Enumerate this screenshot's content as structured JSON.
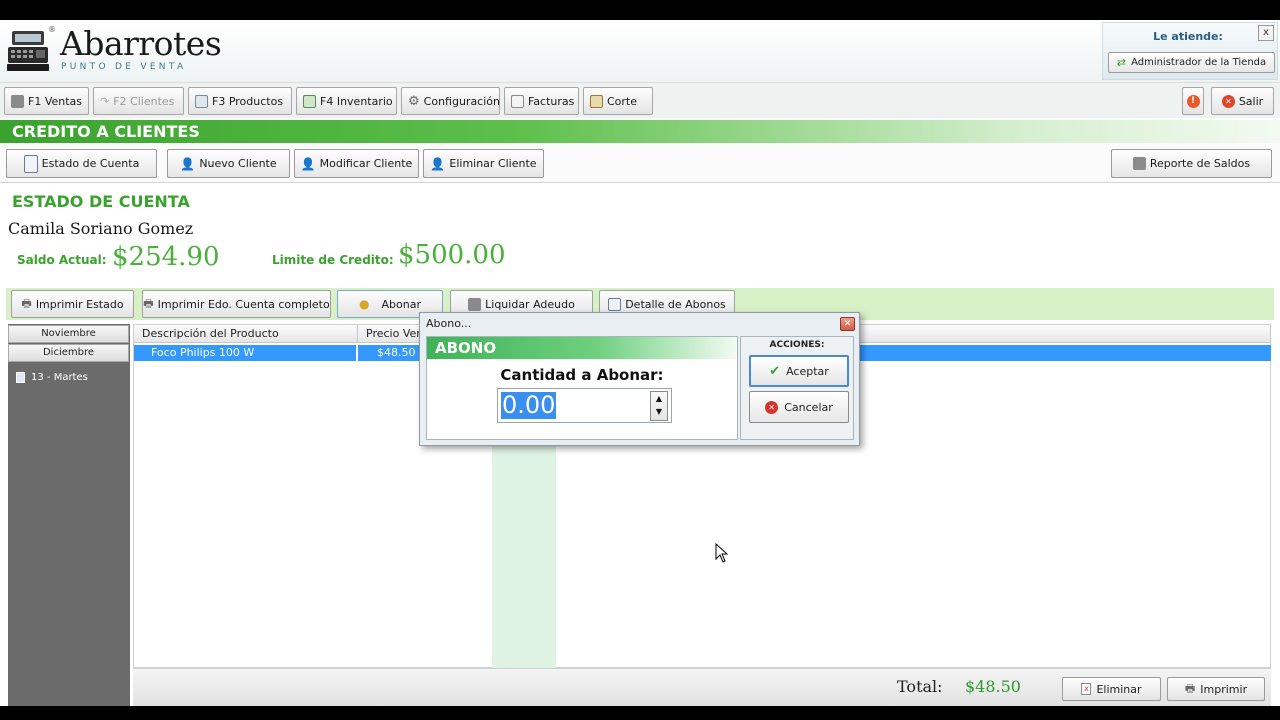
{
  "app": {
    "logo_title": "Abarrotes",
    "logo_subtitle": "PUNTO DE VENTA",
    "logo_reg": "®"
  },
  "attend": {
    "label": "Le atiende:",
    "user": "Administrador de la Tienda",
    "close": "x"
  },
  "toolbar": {
    "ventas": "F1 Ventas",
    "clientes": "F2 Clientes",
    "productos": "F3 Productos",
    "inventario": "F4 Inventario",
    "configuracion": "Configuración",
    "facturas": "Facturas",
    "corte": "Corte",
    "salir": "Salir"
  },
  "section": {
    "title": "CREDITO A CLIENTES",
    "estado_cuenta": "Estado de Cuenta",
    "nuevo_cliente": "Nuevo Cliente",
    "modificar_cliente": "Modificar Cliente",
    "eliminar_cliente": "Eliminar Cliente",
    "reporte_saldos": "Reporte de Saldos"
  },
  "estado": {
    "title": "ESTADO DE CUENTA",
    "client_name": "Camila Soriano Gomez",
    "saldo_label": "Saldo Actual:",
    "saldo_value": "$254.90",
    "limite_label": "Limite de Credito:",
    "limite_value": "$500.00"
  },
  "actions": {
    "imprimir_estado": "Imprimir Estado",
    "imprimir_completo": "Imprimir Edo. Cuenta completo",
    "abonar": "Abonar",
    "liquidar": "Liquidar Adeudo",
    "detalle": "Detalle de Abonos"
  },
  "tree": {
    "month1": "Noviembre",
    "month2": "Diciembre",
    "day": "13 - Martes"
  },
  "grid": {
    "columns": [
      "Descripción del Producto",
      "Precio Ven"
    ],
    "rows": [
      {
        "descripcion": "Foco Philips 100 W",
        "precio": "$48.50"
      }
    ]
  },
  "footer": {
    "total_label": "Total:",
    "total_value": "$48.50",
    "eliminar": "Eliminar",
    "imprimir": "Imprimir"
  },
  "dialog": {
    "title": "Abono...",
    "header": "ABONO",
    "question": "Cantidad a Abonar:",
    "value": "0.00",
    "actions_label": "ACCIONES:",
    "aceptar": "Aceptar",
    "cancelar": "Cancelar"
  },
  "colors": {
    "accent_green": "#3aa22e",
    "selection_blue": "#3399ff"
  }
}
